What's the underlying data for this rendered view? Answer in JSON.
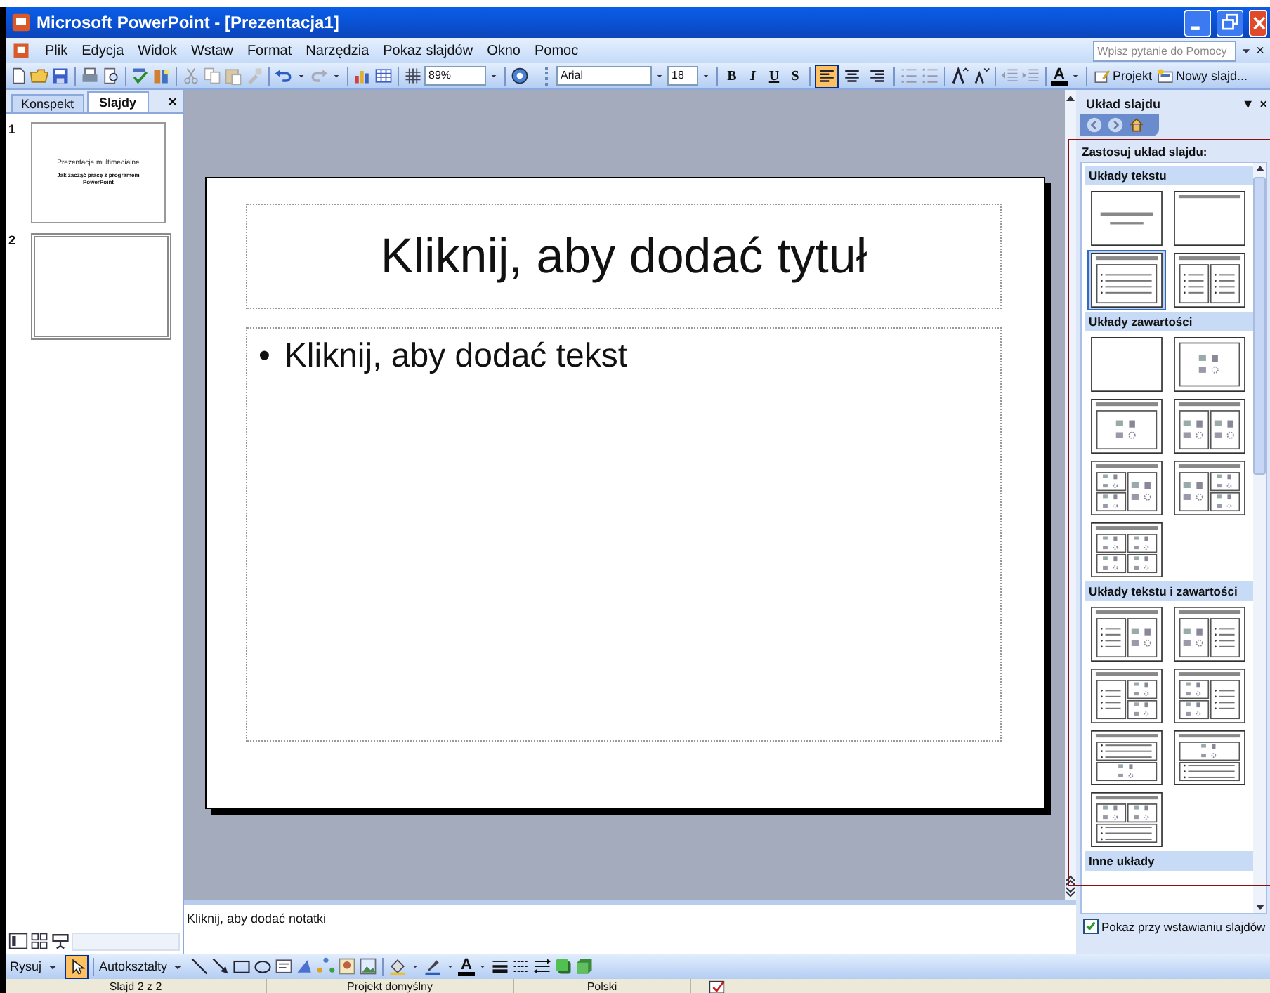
{
  "window": {
    "title": "Microsoft PowerPoint - [Prezentacja1]"
  },
  "menu": [
    "Plik",
    "Edycja",
    "Widok",
    "Wstaw",
    "Format",
    "Narzędzia",
    "Pokaz slajdów",
    "Okno",
    "Pomoc"
  ],
  "help_box": {
    "placeholder": "Wpisz pytanie do Pomocy",
    "close": "×"
  },
  "toolbar": {
    "zoom": "89%",
    "font": "Arial",
    "font_size": "18",
    "format_buttons": [
      "B",
      "I",
      "U",
      "S"
    ],
    "alignment": [
      {
        "selected": true
      },
      {
        "selected": false
      },
      {
        "selected": false
      }
    ],
    "font_color": "A",
    "design_button": "Projekt",
    "new_slide_button": "Nowy slajd..."
  },
  "left_panel": {
    "tabs": [
      {
        "label": "Konspekt",
        "selected": false
      },
      {
        "label": "Slajdy",
        "selected": true
      }
    ],
    "close": "×",
    "slides": [
      {
        "number": "1",
        "selected": false,
        "title": "Prezentacje multimedialne",
        "subtitle": "Jak zacząć pracę z programem PowerPoint"
      },
      {
        "number": "2",
        "selected": true
      }
    ]
  },
  "slide": {
    "title": "Kliknij, aby dodać tytuł",
    "bullet": "•",
    "body": "Kliknij, aby dodać tekst"
  },
  "notes": {
    "prompt": "Kliknij, aby dodać notatki"
  },
  "task_pane": {
    "title": "Układ slajdu",
    "menu_glyph": "▼",
    "close": "×",
    "heading": "Zastosuj układ slajdu:",
    "sections": [
      {
        "title": "Układy tekstu",
        "items": [
          {
            "kind": "title-slide",
            "selected": false
          },
          {
            "kind": "title-only",
            "selected": false
          },
          {
            "kind": "title-text",
            "selected": true
          },
          {
            "kind": "two-text",
            "selected": false
          }
        ]
      },
      {
        "title": "Układy zawartości",
        "items": [
          {
            "kind": "blank",
            "selected": false
          },
          {
            "kind": "content",
            "selected": false
          },
          {
            "kind": "title-content",
            "selected": false
          },
          {
            "kind": "title-two-content",
            "selected": false
          },
          {
            "kind": "title-content-two",
            "selected": false
          },
          {
            "kind": "title-two-content-right",
            "selected": false
          },
          {
            "kind": "title-four-content",
            "selected": false
          }
        ]
      },
      {
        "title": "Układy tekstu i zawartości",
        "items": [
          {
            "kind": "text-content",
            "selected": false
          },
          {
            "kind": "content-text",
            "selected": false
          },
          {
            "kind": "text-two-content",
            "selected": false
          },
          {
            "kind": "two-content-text",
            "selected": false
          },
          {
            "kind": "text-over-content",
            "selected": false
          },
          {
            "kind": "content-over-text",
            "selected": false
          },
          {
            "kind": "two-content-over-text",
            "selected": false
          }
        ]
      },
      {
        "title": "Inne układy"
      }
    ],
    "show_on_insert": {
      "label": "Pokaż przy wstawianiu slajdów",
      "checked": true
    }
  },
  "drawing_toolbar": {
    "draw_menu": "Rysuj",
    "select_tool": {
      "selected": true
    },
    "autoshapes": "Autokształty",
    "font_color": "A"
  },
  "status_bar": [
    "Slajd 2 z 2",
    "Projekt domyślny",
    "Polski"
  ]
}
